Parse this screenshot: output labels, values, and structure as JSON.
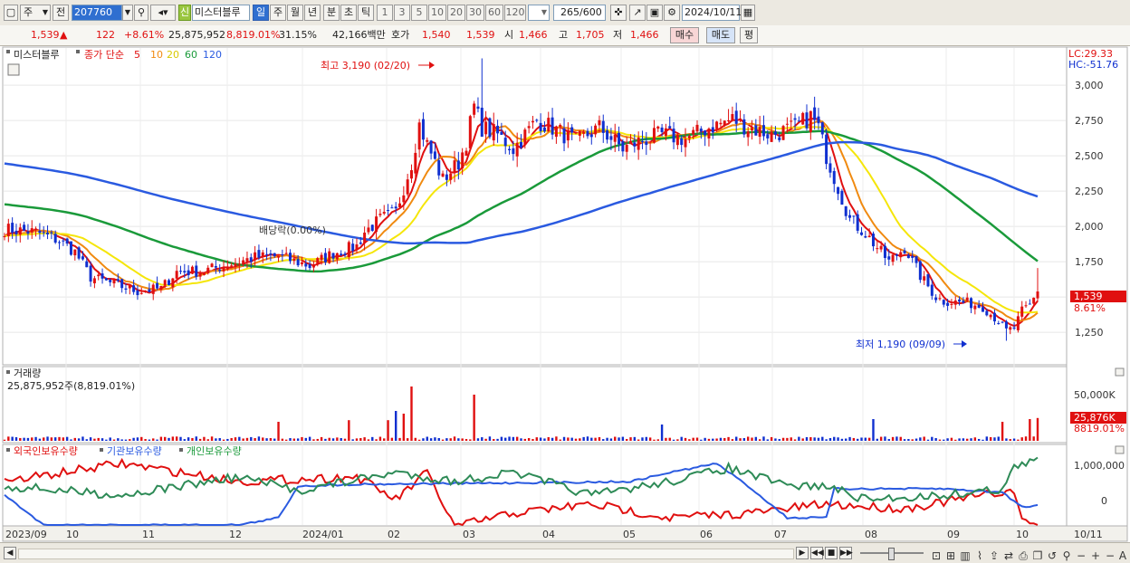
{
  "toolbar": {
    "market": "주",
    "prev": "전",
    "code": "207760",
    "name": "미스터블루",
    "new_badge": "신",
    "periods": [
      "일",
      "주",
      "월",
      "년",
      "분",
      "초",
      "틱"
    ],
    "active_period": "일",
    "intervals": [
      "1",
      "3",
      "5",
      "10",
      "20",
      "30",
      "60",
      "120"
    ],
    "count": "265",
    "count_max": "/600",
    "date": "2024/10/11"
  },
  "quote": {
    "price": "1,539",
    "arrow": "▲",
    "change": "122",
    "change_pct": "+8.61%",
    "volume": "25,875,952",
    "volume_pct": "8,819.01%",
    "turnover": "31.15%",
    "amount": "42,166백만",
    "ask_label": "호가",
    "ask": "1,540",
    "bid": "1,539",
    "open_label": "시",
    "open": "1,466",
    "high_label": "고",
    "high": "1,705",
    "low_label": "저",
    "low": "1,466",
    "buy": "매수",
    "sell": "매도",
    "eval": "평"
  },
  "price_panel": {
    "legend_name": "미스터블루",
    "legend_ma": "종가 단순",
    "ma_periods": [
      "5",
      "10",
      "20",
      "60",
      "120"
    ],
    "lc": "LC:29.33",
    "hc": "HC:-51.76",
    "high_label": "최고 3,190 (02/20)",
    "low_label": "최저 1,190 (09/09)",
    "dividend_label": "배당락(0.00%)",
    "last_price_tag": "1,539",
    "last_pct_tag": "8.61%",
    "colors": {
      "ma5": "#e01010",
      "ma10": "#f08a10",
      "ma20": "#f5e60a",
      "ma60": "#1a9a3a",
      "ma120": "#2a5ae0",
      "up": "#e01010",
      "down": "#1030d0"
    }
  },
  "volume_panel": {
    "title": "거래량",
    "value_label": "25,875,952주(8,819.01%)",
    "tick": "50,000K",
    "tag": "25,876K",
    "tag_pct": "8819.01%"
  },
  "holder_panel": {
    "foreign": "외국인보유수량",
    "institution": "기관보유수량",
    "individual": "개인보유수량",
    "ticks": [
      "1,000,000",
      "0"
    ]
  },
  "x_axis_labels": [
    "2023/09",
    "10",
    "11",
    "12",
    "2024/01",
    "02",
    "03",
    "04",
    "05",
    "06",
    "07",
    "08",
    "09",
    "10",
    "10/11"
  ],
  "chart_data": {
    "type": "candlestick",
    "y_ticks": [
      3000,
      2750,
      2500,
      2250,
      2000,
      1750,
      1500,
      1250
    ],
    "ylim": [
      1020,
      3270
    ],
    "months": [
      "2023/09",
      "10",
      "11",
      "12",
      "2024/01",
      "02",
      "03",
      "04",
      "05",
      "06",
      "07",
      "08",
      "09",
      "10"
    ],
    "close_series_approx": [
      {
        "month": "2023/09",
        "close": 1950
      },
      {
        "month": "10",
        "close": 1520
      },
      {
        "month": "11",
        "close": 1650
      },
      {
        "month": "12",
        "close": 1780
      },
      {
        "month": "2024/01",
        "close": 2000
      },
      {
        "month": "02",
        "close": 2300
      },
      {
        "month": "03",
        "close": 2700
      },
      {
        "month": "04",
        "close": 2600
      },
      {
        "month": "05",
        "close": 2650
      },
      {
        "month": "06",
        "close": 2750
      },
      {
        "month": "07",
        "close": 1900
      },
      {
        "month": "08",
        "close": 1450
      },
      {
        "month": "09",
        "close": 1270
      },
      {
        "month": "10",
        "close": 1539
      }
    ],
    "high": {
      "value": 3190,
      "date": "02/20"
    },
    "low": {
      "value": 1190,
      "date": "09/09"
    },
    "last": 1539
  }
}
